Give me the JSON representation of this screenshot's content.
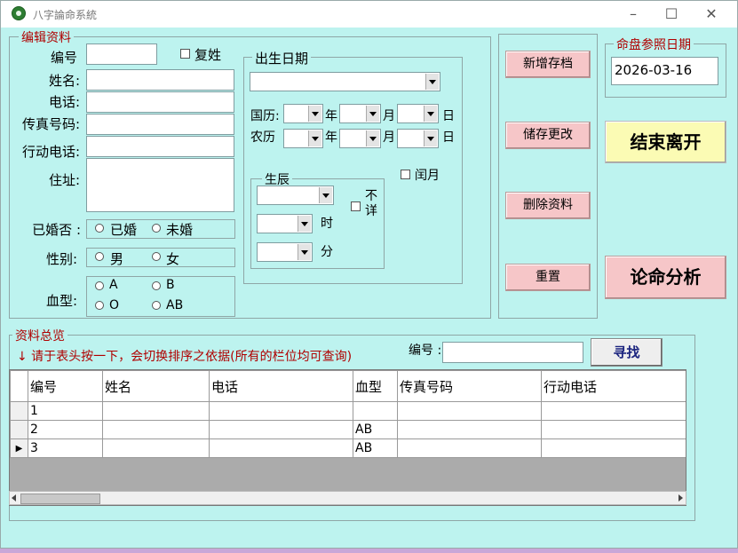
{
  "window": {
    "title": "八字論命系統"
  },
  "edit_section": {
    "legend": "编辑资料",
    "fields": {
      "number": {
        "label": "编号",
        "value": ""
      },
      "compound_surname": {
        "label": "复姓"
      },
      "name": {
        "label": "姓名:",
        "value": ""
      },
      "phone": {
        "label": "电话:",
        "value": ""
      },
      "fax": {
        "label": "传真号码:",
        "value": ""
      },
      "mobile": {
        "label": "行动电话:",
        "value": ""
      },
      "address": {
        "label": "住址:",
        "value": ""
      }
    },
    "married": {
      "label": "已婚否 :",
      "options": [
        "已婚",
        "未婚"
      ]
    },
    "gender": {
      "label": "性别:",
      "options": [
        "男",
        "女"
      ]
    },
    "blood": {
      "label": "血型:",
      "options": [
        "A",
        "B",
        "O",
        "AB"
      ]
    }
  },
  "birth": {
    "legend": "出生日期",
    "solar_label": "国历:",
    "lunar_label": "农历",
    "year": "年",
    "month": "月",
    "day": "日",
    "leap_month": "闰月",
    "hour_legend": "生辰",
    "hour_unit": "时",
    "minute_unit": "分",
    "unknown": "不详"
  },
  "buttons": {
    "add": "新增存档",
    "save": "储存更改",
    "delete": "删除资料",
    "reset": "重置",
    "exit": "结束离开",
    "analyze": "论命分析",
    "find": "寻找"
  },
  "ref_date": {
    "legend": "命盘参照日期",
    "value": "2026-03-16"
  },
  "summary": {
    "legend": "资料总览",
    "hint": "↓ 请于表头按一下，会切换排序之依据(所有的栏位均可查询)",
    "search_label": "编号 :",
    "search_value": "",
    "columns": [
      "编号",
      "姓名",
      "电话",
      "血型",
      "传真号码",
      "行动电话"
    ],
    "rows": [
      {
        "selected": false,
        "cells": [
          "1",
          "",
          "",
          "",
          "",
          ""
        ]
      },
      {
        "selected": false,
        "cells": [
          "2",
          "",
          "",
          "AB",
          "",
          ""
        ]
      },
      {
        "selected": true,
        "cells": [
          "3",
          "",
          "",
          "AB",
          "",
          ""
        ]
      }
    ]
  },
  "colors": {
    "form_bg": "#bdf3ef",
    "legend_red": "#b00000",
    "pink_button": "#f6c6c8",
    "yellow_button": "#fbfbb4"
  }
}
